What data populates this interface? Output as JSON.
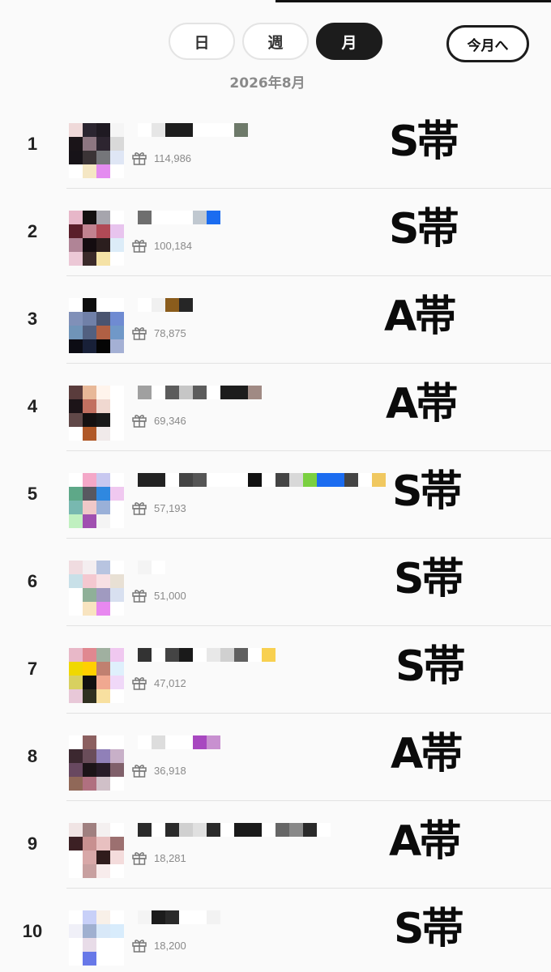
{
  "tabs": {
    "day": "日",
    "week": "週",
    "month": "月",
    "active": "month"
  },
  "to_month_label": "今月へ",
  "period": "2026年8月",
  "rows": [
    {
      "rank": "1",
      "gifts": "114,986",
      "tier": "S帯",
      "avatar": [
        "#efd9d9",
        "#2b2530",
        "#1f1a22",
        "#f5f5f5",
        "#1a1418",
        "#8d7681",
        "#2d2530",
        "#d9d9d9",
        "#171318",
        "#3b3436",
        "#75767a",
        "#dfe6f5",
        "#ffffff",
        "#f5e7c4",
        "#e48cf0",
        "#ffffff"
      ],
      "name": [
        "#ffffff",
        "#e6e6e6",
        "#1e1e1e",
        "#1e1e1e",
        "#ffffff",
        "#ffffff",
        "#ffffff",
        "#6e7a6a"
      ]
    },
    {
      "rank": "2",
      "gifts": "100,184",
      "tier": "S帯",
      "avatar": [
        "#e7b7c9",
        "#141010",
        "#a6a5ad",
        "#ffffff",
        "#5a1e2a",
        "#c28290",
        "#b04a56",
        "#e8c4ee",
        "#b08496",
        "#140c10",
        "#2b1e1e",
        "#dcecf8",
        "#ecc8d6",
        "#3b2a2a",
        "#f5e2a6",
        "#ffffff"
      ],
      "name": [
        "#6e6e6e",
        "#ffffff",
        "#ffffff",
        "#ffffff",
        "#c0c8d0",
        "#1b6cf0"
      ]
    },
    {
      "rank": "3",
      "gifts": "78,875",
      "tier": "A帯",
      "avatar": [
        "#ffffff",
        "#0d0d0d",
        "#ffffff",
        "#ffffff",
        "#8090b8",
        "#7080a8",
        "#4a5470",
        "#6f8bd2",
        "#7094b8",
        "#526080",
        "#b06044",
        "#7098c8",
        "#0c0c14",
        "#182038",
        "#050505",
        "#a4b0d4"
      ],
      "name": [
        "#ffffff",
        "#f0f0f0",
        "#8a5c1c",
        "#262626"
      ]
    },
    {
      "rank": "4",
      "gifts": "69,346",
      "tier": "A帯",
      "avatar": [
        "#5a3c3c",
        "#e8b898",
        "#fff4ec",
        "#ffffff",
        "#1c1418",
        "#c27060",
        "#f0d8d0",
        "#ffffff",
        "#604848",
        "#141010",
        "#181818",
        "#ffffff",
        "#ffffff",
        "#b05828",
        "#f0eaea",
        "#ffffff"
      ],
      "name": [
        "#a0a0a0",
        "#ffffff",
        "#5c5c5c",
        "#c6c6c6",
        "#5c5c5c",
        "#ffffff",
        "#1c1c1c",
        "#1c1c1c",
        "#a08a84"
      ]
    },
    {
      "rank": "5",
      "gifts": "57,193",
      "tier": "S帯",
      "avatar": [
        "#ffffff",
        "#f4a8c8",
        "#c8c8f0",
        "#ffffff",
        "#5ea888",
        "#585860",
        "#2f88e0",
        "#f0c8f0",
        "#78b8b0",
        "#f0c8c8",
        "#9ab0d8",
        "#ffffff",
        "#c0f0c0",
        "#a050b0",
        "#f4f4f4",
        "#ffffff"
      ],
      "name": [
        "#222222",
        "#222222",
        "#ffffff",
        "#444444",
        "#555555",
        "#ffffff",
        "#ffffff",
        "#ffffff",
        "#111111",
        "#ffffff",
        "#444444",
        "#d8d8d8",
        "#7ad040",
        "#1b6cf0",
        "#1b6cf0",
        "#444444",
        "#ffffff",
        "#f0c860"
      ]
    },
    {
      "rank": "6",
      "gifts": "51,000",
      "tier": "S帯",
      "avatar": [
        "#f0dce0",
        "#f4eef0",
        "#b8c4e0",
        "#ffffff",
        "#c8e0e8",
        "#f4c8d0",
        "#f8e0e4",
        "#e8e0d4",
        "#ffffff",
        "#8fb098",
        "#a09ac0",
        "#d8e0f0",
        "#ffffff",
        "#f8e4c0",
        "#e888f0",
        "#ffffff"
      ],
      "name": [
        "#f4f4f4",
        "#ffffff"
      ]
    },
    {
      "rank": "7",
      "gifts": "47,012",
      "tier": "S帯",
      "avatar": [
        "#e8b8c8",
        "#e08890",
        "#a0b0a0",
        "#f0c8f0",
        "#f0d800",
        "#ffd000",
        "#c08070",
        "#dff0fc",
        "#d8d060",
        "#101010",
        "#f0a890",
        "#f0d8f8",
        "#e8c8d8",
        "#303020",
        "#f8e0a0",
        "#ffffff"
      ],
      "name": [
        "#333333",
        "#ffffff",
        "#444444",
        "#1a1a1a",
        "#ffffff",
        "#e8e8e8",
        "#d0d0d0",
        "#606060",
        "#ffffff",
        "#f8d050"
      ]
    },
    {
      "rank": "8",
      "gifts": "36,918",
      "tier": "A帯",
      "avatar": [
        "#ffffff",
        "#8c6060",
        "#ffffff",
        "#ffffff",
        "#3c2830",
        "#6a4d5a",
        "#9080b8",
        "#c8b0c8",
        "#684860",
        "#1c1418",
        "#281c28",
        "#80606a",
        "#906858",
        "#b07080",
        "#d0c0c8",
        "#ffffff"
      ],
      "name": [
        "#ffffff",
        "#dddddd",
        "#ffffff",
        "#ffffff",
        "#a848c0",
        "#c890d0"
      ]
    },
    {
      "rank": "9",
      "gifts": "18,281",
      "tier": "A帯",
      "avatar": [
        "#f0e4e4",
        "#a08080",
        "#f4f0f0",
        "#ffffff",
        "#3c2024",
        "#c89090",
        "#e8c0c0",
        "#9c7070",
        "#ffffff",
        "#d8a8a8",
        "#301c1c",
        "#f4dcdc",
        "#ffffff",
        "#c8a0a0",
        "#f8ecec",
        "#ffffff"
      ],
      "name": [
        "#2a2a2a",
        "#ffffff",
        "#2a2a2a",
        "#d0d0d0",
        "#e0e0e0",
        "#2a2a2a",
        "#ffffff",
        "#1a1a1a",
        "#1a1a1a",
        "#ffffff",
        "#666666",
        "#888888",
        "#2a2a2a",
        "#ffffff"
      ]
    },
    {
      "rank": "10",
      "gifts": "18,200",
      "tier": "S帯",
      "avatar": [
        "#ffffff",
        "#c8d0f8",
        "#f8f0e8",
        "#ffffff",
        "#f0f0f8",
        "#a0b0d0",
        "#d8e8f8",
        "#d8ecfc",
        "#ffffff",
        "#e8dce8",
        "#ffffff",
        "#ffffff",
        "#ffffff",
        "#6878e8",
        "#ffffff",
        "#ffffff"
      ],
      "name": [
        "#f4f4f4",
        "#1c1c1c",
        "#2a2a2a",
        "#ffffff",
        "#ffffff",
        "#f2f2f2"
      ]
    }
  ],
  "colors": {
    "active_tab": "#1c1c1c",
    "muted_text": "#8a8a8a",
    "divider": "#e2e2e2"
  }
}
